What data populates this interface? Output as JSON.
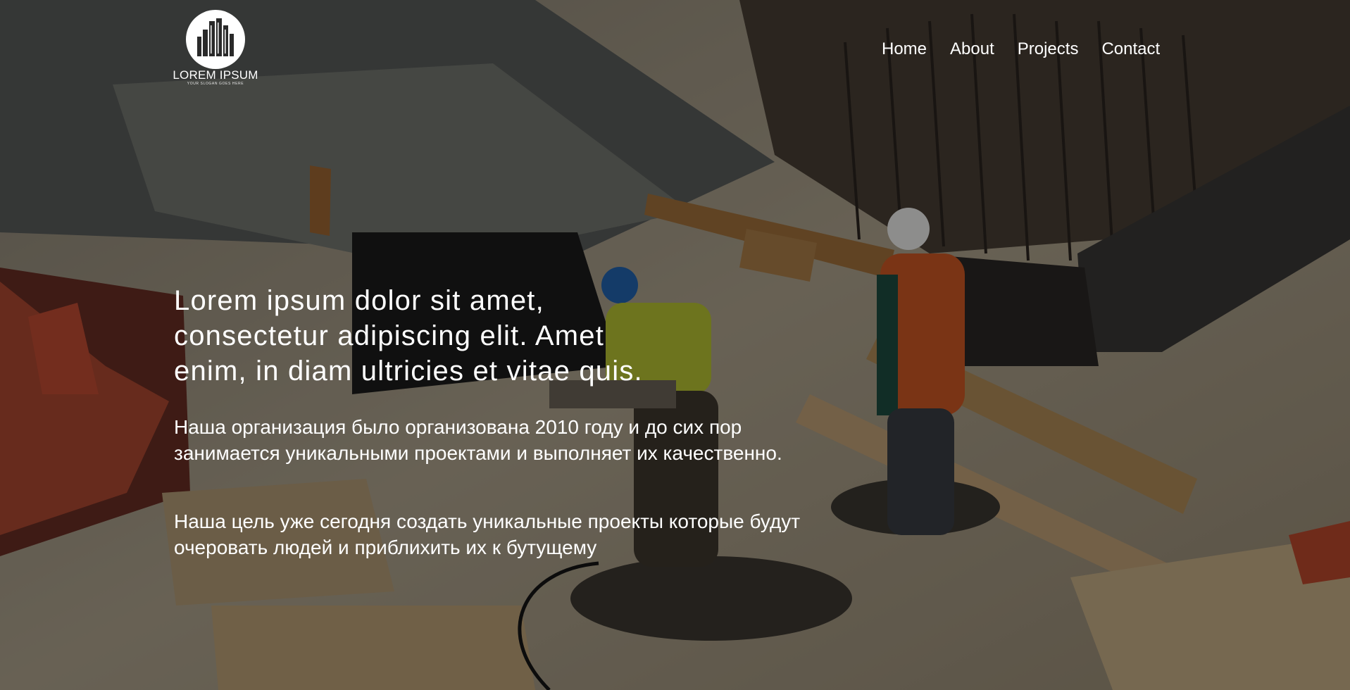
{
  "logo": {
    "name": "LOREM IPSUM",
    "slogan": "YOUR SLOGAN GOES HERE",
    "icon": "city-buildings-icon"
  },
  "nav": {
    "items": [
      {
        "label": "Home"
      },
      {
        "label": "About"
      },
      {
        "label": "Projects"
      },
      {
        "label": "Contact"
      }
    ]
  },
  "hero": {
    "headline_lines": [
      "Lorem ipsum dolor sit amet,",
      "consectetur adipiscing elit. Amet",
      "enim, in diam ultricies et vitae quis."
    ],
    "paragraph_1_lines": [
      "Наша организация было организована 2010 году и до сих пор",
      "занимается уникальными проектами и выполняет их качественно."
    ],
    "paragraph_2_lines": [
      "Наша цель уже сегодня создать уникальные проекты которые будут",
      "очеровать людей и приблихить их к бутущему"
    ],
    "background": "construction-site-photo"
  },
  "colors": {
    "text": "#ffffff",
    "overlay": "rgba(0,0,0,0.42)"
  }
}
